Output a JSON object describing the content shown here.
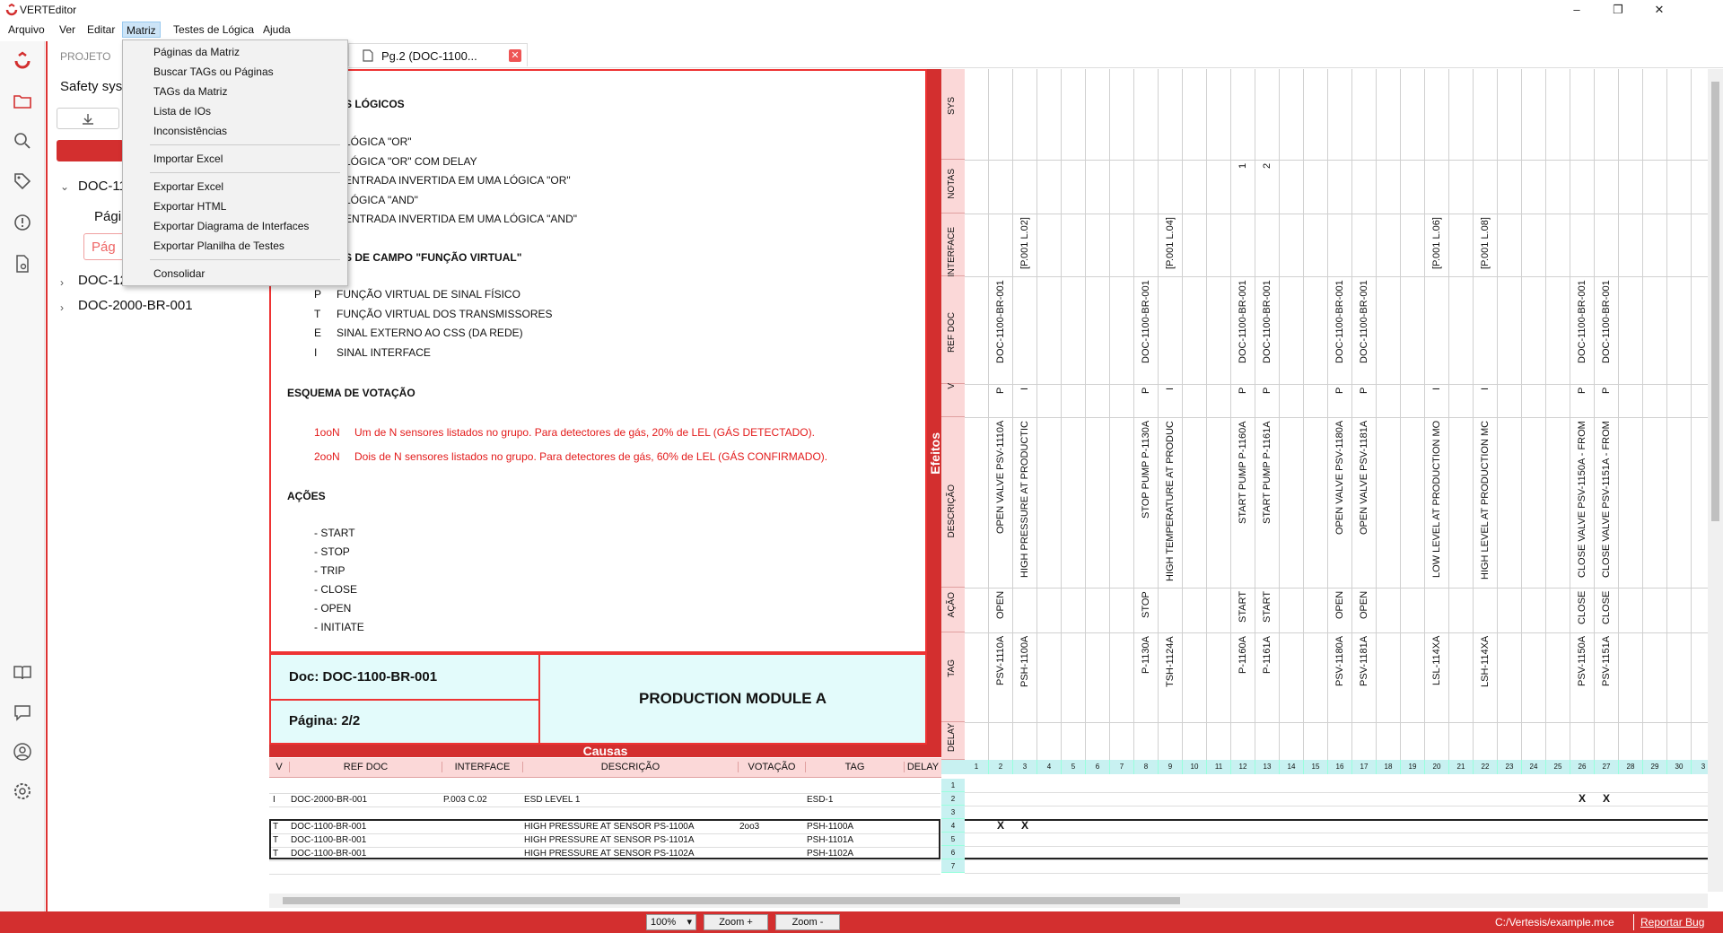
{
  "app": {
    "title": "VERTEditor"
  },
  "menu": [
    "Arquivo",
    "Ver",
    "Editar",
    "Matriz",
    "Testes de Lógica",
    "Ajuda"
  ],
  "dropdown": {
    "items": [
      "Páginas da Matriz",
      "Buscar TAGs ou Páginas",
      "TAGs da Matriz",
      "Lista de IOs",
      "Inconsistências",
      "Importar Excel",
      "Exportar Excel",
      "Exportar HTML",
      "Exportar Diagrama de Interfaces",
      "Exportar Planilha de Testes",
      "Consolidar"
    ]
  },
  "sidebar": {
    "header": "PROJETO",
    "project": "Safety sys",
    "tree": [
      "DOC-11",
      "Págin",
      "Pág",
      "DOC-12",
      "DOC-2000-BR-001"
    ]
  },
  "tab": {
    "label": "Pg.2 (DOC-1100..."
  },
  "legend": {
    "logicos_title": "S LÓGICOS",
    "logicos": [
      "LÓGICA \"OR\"",
      "LÓGICA \"OR\" COM DELAY",
      "ENTRADA INVERTIDA EM UMA LÓGICA \"OR\"",
      "LÓGICA \"AND\"",
      "ENTRADA INVERTIDA EM UMA LÓGICA \"AND\""
    ],
    "campo_title": "S DE CAMPO \"FUNÇÃO VIRTUAL\"",
    "campo": [
      {
        "k": "P",
        "v": "FUNÇÃO VIRTUAL DE SINAL FÍSICO"
      },
      {
        "k": "T",
        "v": "FUNÇÃO VIRTUAL DOS TRANSMISSORES"
      },
      {
        "k": "E",
        "v": "SINAL EXTERNO AO CSS (DA REDE)"
      },
      {
        "k": "I",
        "v": "SINAL INTERFACE"
      }
    ],
    "votacao_title": "ESQUEMA DE VOTAÇÃO",
    "votacao": [
      {
        "k": "1ooN",
        "v": "Um de N sensores listados no grupo. Para detectores de gás, 20% de LEL (GÁS DETECTADO)."
      },
      {
        "k": "2ooN",
        "v": "Dois de N sensores listados no grupo. Para detectores de gás, 60% de LEL (GÁS CONFIRMADO)."
      }
    ],
    "acoes_title": "AÇÕES",
    "acoes": [
      "- START",
      "- STOP",
      "- TRIP",
      "- CLOSE",
      "- OPEN",
      "- INITIATE"
    ]
  },
  "footer": {
    "doc": "Doc: DOC-1100-BR-001",
    "page": "Página: 2/2",
    "module": "PRODUCTION MODULE A"
  },
  "efeitos_label": "Efeitos",
  "causas_label": "Causas",
  "effect_row_headers": [
    "SYS",
    "NOTAS",
    "INTERFACE",
    "REF DOC",
    "V",
    "DESCRIÇÃO",
    "AÇÃO",
    "TAG",
    "DELAY"
  ],
  "cause_headers": [
    "V",
    "REF DOC",
    "INTERFACE",
    "DESCRIÇÃO",
    "VOTAÇÃO",
    "TAG",
    "DELAY"
  ],
  "effects": [
    {
      "col": 1
    },
    {
      "col": 2,
      "refdoc": "DOC-1100-BR-001",
      "v": "P",
      "desc": "OPEN VALVE PSV-1110A",
      "acao": "OPEN",
      "tag": "PSV-1110A"
    },
    {
      "col": 3,
      "interface": "[P.001 L.02]",
      "v": "I",
      "desc": "HIGH PRESSURE AT PRODUCTIC",
      "tag": "PSH-1100A"
    },
    {
      "col": 8,
      "refdoc": "DOC-1100-BR-001",
      "v": "P",
      "desc": "STOP PUMP P-1130A",
      "acao": "STOP",
      "tag": "P-1130A"
    },
    {
      "col": 9,
      "interface": "[P.001 L.04]",
      "v": "I",
      "desc": "HIGH TEMPERATURE AT PRODUC",
      "tag": "TSH-1124A"
    },
    {
      "col": 12,
      "notas": "1",
      "refdoc": "DOC-1100-BR-001",
      "v": "P",
      "desc": "START PUMP P-1160A",
      "acao": "START",
      "tag": "P-1160A"
    },
    {
      "col": 13,
      "notas": "2",
      "refdoc": "DOC-1100-BR-001",
      "v": "P",
      "desc": "START PUMP P-1161A",
      "acao": "START",
      "tag": "P-1161A"
    },
    {
      "col": 16,
      "refdoc": "DOC-1100-BR-001",
      "v": "P",
      "desc": "OPEN VALVE PSV-1180A",
      "acao": "OPEN",
      "tag": "PSV-1180A"
    },
    {
      "col": 17,
      "refdoc": "DOC-1100-BR-001",
      "v": "P",
      "desc": "OPEN VALVE PSV-1181A",
      "acao": "OPEN",
      "tag": "PSV-1181A"
    },
    {
      "col": 20,
      "interface": "[P.001 L.06]",
      "v": "I",
      "desc": "LOW LEVEL AT PRODUCTION MO",
      "tag": "LSL-114XA"
    },
    {
      "col": 22,
      "interface": "[P.001 L.08]",
      "v": "I",
      "desc": "HIGH LEVEL AT PRODUCTION MC",
      "tag": "LSH-114XA"
    },
    {
      "col": 26,
      "refdoc": "DOC-1100-BR-001",
      "v": "P",
      "desc": "CLOSE VALVE PSV-1150A - FROM",
      "acao": "CLOSE",
      "tag": "PSV-1150A"
    },
    {
      "col": 27,
      "refdoc": "DOC-1100-BR-001",
      "v": "P",
      "desc": "CLOSE VALVE PSV-1151A - FROM",
      "acao": "CLOSE",
      "tag": "PSV-1151A"
    }
  ],
  "col_numbers": [
    "1",
    "2",
    "3",
    "4",
    "5",
    "6",
    "7",
    "8",
    "9",
    "10",
    "11",
    "12",
    "13",
    "14",
    "15",
    "16",
    "17",
    "18",
    "19",
    "20",
    "21",
    "22",
    "23",
    "24",
    "25",
    "26",
    "27",
    "28",
    "29",
    "30",
    "3"
  ],
  "causes": [
    {
      "row": "1"
    },
    {
      "row": "2",
      "v": "I",
      "refdoc": "DOC-2000-BR-001",
      "interface": "P.003 C.02",
      "desc": "ESD LEVEL 1",
      "tag": "ESD-1",
      "marks": [
        26,
        27
      ]
    },
    {
      "row": "3"
    },
    {
      "row": "4",
      "v": "T",
      "refdoc": "DOC-1100-BR-001",
      "desc": "HIGH PRESSURE AT SENSOR PS-1100A",
      "votacao": "2oo3",
      "tag": "PSH-1100A",
      "marks": [
        2,
        3
      ]
    },
    {
      "row": "5",
      "v": "T",
      "refdoc": "DOC-1100-BR-001",
      "desc": "HIGH PRESSURE AT SENSOR PS-1101A",
      "tag": "PSH-1101A"
    },
    {
      "row": "6",
      "v": "T",
      "refdoc": "DOC-1100-BR-001",
      "desc": "HIGH PRESSURE AT SENSOR PS-1102A",
      "tag": "PSH-1102A"
    },
    {
      "row": "7"
    }
  ],
  "mark": "X",
  "status": {
    "zoom": "100%",
    "zoom_in": "Zoom +",
    "zoom_out": "Zoom -",
    "path": "C:/Vertesis/example.mce",
    "report": "Reportar Bug"
  },
  "colors": {
    "accent": "#d32f2f",
    "cyan": "#e3fbfb",
    "pink": "#fbd8d8"
  }
}
